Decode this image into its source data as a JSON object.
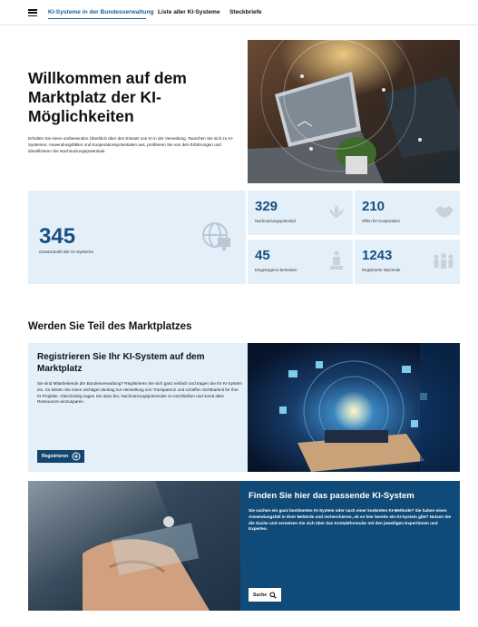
{
  "nav": {
    "menu_icon": "hamburger-menu-icon",
    "links": [
      "KI-Systeme in der Bundesverwaltung",
      "Liste aller KI-Systeme",
      "Steckbriefe"
    ]
  },
  "hero": {
    "title": "Willkommen auf dem Marktplatz der KI-Möglichkeiten",
    "text": "Erhalten Sie einen umfassenden Überblick über den Einsatz von KI in der Verwaltung. Tauschen Sie sich zu KI-Systemen, Anwendungsfällen und Kooperationspotentialen aus, profitieren Sie von den Erfahrungen und identifizieren Sie Nachnutzungspotentiale."
  },
  "stats": {
    "main": {
      "value": "345",
      "label": "Gesamtzahl der KI-Systeme",
      "icon": "globe-monitor-icon"
    },
    "items": [
      {
        "value": "329",
        "label": "Nachnutzungspotential",
        "icon": "lotus-icon"
      },
      {
        "value": "210",
        "label": "Offen für Kooperation",
        "icon": "handshake-icon"
      },
      {
        "value": "45",
        "label": "Eingetragene Behörden",
        "icon": "building-icon"
      },
      {
        "value": "1243",
        "label": "Registrierte Nutzende",
        "icon": "users-icon"
      }
    ]
  },
  "section": {
    "title": "Werden Sie Teil des Marktplatzes"
  },
  "register": {
    "title": "Registrieren Sie Ihr KI-System auf dem Marktplatz",
    "text": "Sie sind Mitarbeitende der Bundesverwaltung? Registrieren Sie sich ganz einfach und tragen Sie Ihr KI-System ein. So leisten Sie einen wichtigen Beitrag zur Herstellung von Transparenz und schaffen Sichtbarkeit für Ihre KI-Projekte. Gleichzeitig tragen Sie dazu bei, Nachnutzungspotenziale zu erschließen und somit aktiv Ressourcen einzusparen.",
    "button": "Registrieren",
    "button_icon": "plus-circle-icon"
  },
  "find": {
    "title": "Finden Sie hier das passende KI-System",
    "text": "Sie suchen ein ganz bestimmtes KI-System oder nach einer konkreten KI-Methode? Sie haben einen Anwendungsfall in Ihrer Behörde und recherchieren, ob es hier bereits ein KI-System gibt? Nutzen Sie die Suche und vernetzen Sie sich über das Kontaktformular mit den jeweiligen Expertinnen und Experten.",
    "button": "Suche",
    "button_icon": "search-icon"
  }
}
